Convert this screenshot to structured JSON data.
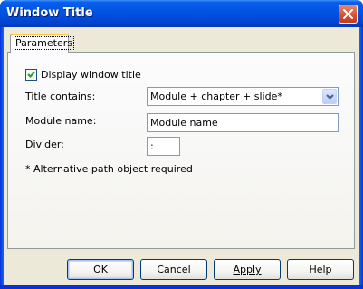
{
  "window": {
    "title": "Window Title"
  },
  "tabs": [
    {
      "label": "Parameters",
      "selected": true
    }
  ],
  "form": {
    "display_title": {
      "label": "Display window title",
      "checked": true
    },
    "title_contains": {
      "label": "Title contains:",
      "value": "Module + chapter + slide*"
    },
    "module_name": {
      "label": "Module name:",
      "value": "Module name"
    },
    "divider": {
      "label": "Divider:",
      "value": ":"
    },
    "note": "* Alternative path object required"
  },
  "buttons": {
    "ok": "OK",
    "cancel": "Cancel",
    "apply": "Apply",
    "help": "Help"
  },
  "colors": {
    "titlebar": "#0055e5",
    "client": "#ece9d8",
    "close_button": "#d8573a",
    "tab_highlight": "#ffc83c",
    "check": "#21a121"
  }
}
